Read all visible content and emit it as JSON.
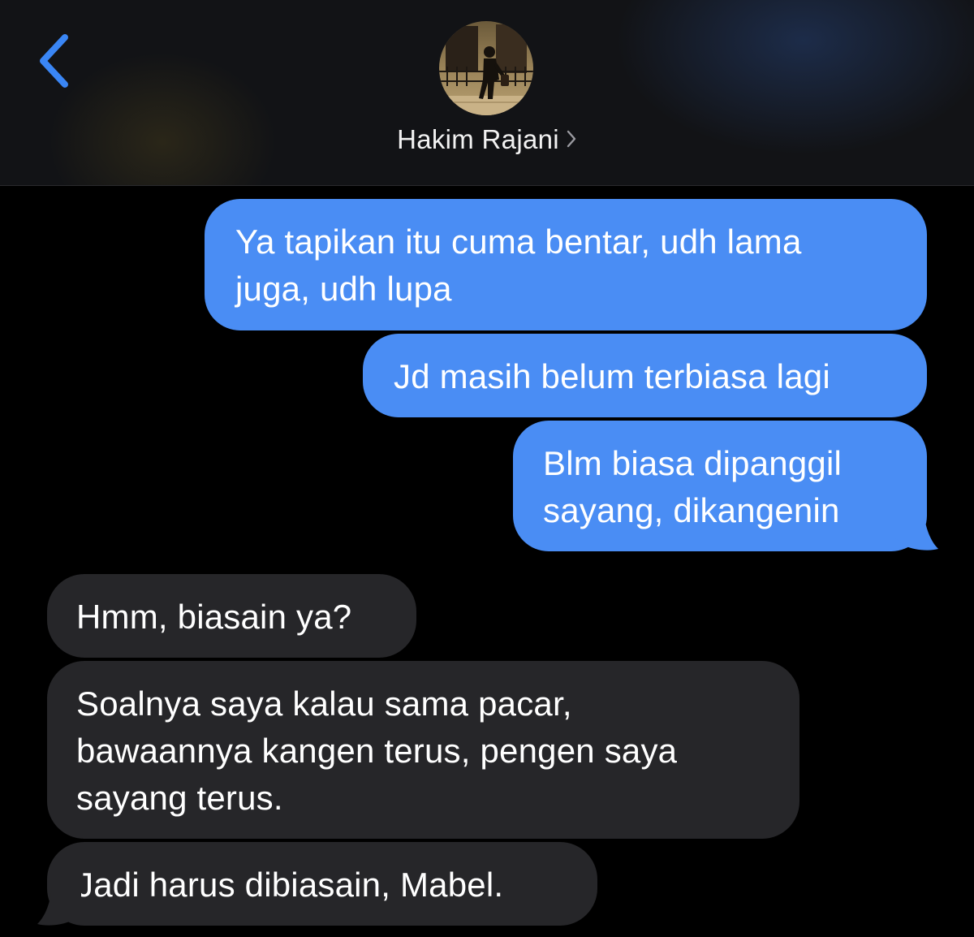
{
  "colors": {
    "accent": "#3a86f5",
    "sent_bubble": "#4a8df4",
    "received_bubble": "#262629",
    "background": "#000000",
    "header_text": "#f2f2f2"
  },
  "header": {
    "back_icon": "chevron-left-icon",
    "avatar_icon": "contact-photo",
    "contact_name": "Hakim Rajani",
    "detail_icon": "chevron-right-icon"
  },
  "messages": [
    {
      "direction": "sent",
      "lines": [
        "Ya tapikan itu cuma bentar, udh lama",
        "juga, udh lupa"
      ]
    },
    {
      "direction": "sent",
      "lines": [
        "Jd masih belum terbiasa lagi"
      ]
    },
    {
      "direction": "sent",
      "lines": [
        "Blm biasa dipanggil",
        "sayang, dikangenin"
      ]
    },
    {
      "direction": "received",
      "lines": [
        "Hmm, biasain ya?"
      ]
    },
    {
      "direction": "received",
      "lines": [
        "Soalnya saya kalau sama pacar,",
        "bawaannya kangen terus, pengen saya",
        "sayang terus."
      ]
    },
    {
      "direction": "received",
      "lines": [
        "Jadi harus dibiasain, Mabel."
      ]
    }
  ]
}
